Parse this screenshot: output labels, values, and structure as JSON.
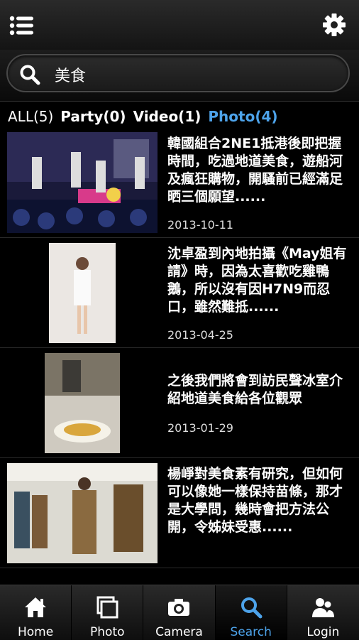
{
  "header": {
    "menu_icon": "hamburger-menu-icon",
    "settings_icon": "gear-icon"
  },
  "search": {
    "value": "美食",
    "icon": "search-icon"
  },
  "filters": [
    {
      "label": "ALL(5)"
    },
    {
      "label": "Party(0)"
    },
    {
      "label": "Video(1)"
    },
    {
      "label": "Photo(4)"
    }
  ],
  "results": [
    {
      "title": "韓國組合2NE1抵港後即把握時間，吃過地道美食，遊船河及瘋狂購物，開騷前已經滿足晒三個願望......",
      "date": "2013-10-11"
    },
    {
      "title": "沈卓盈到內地拍攝《May姐有請》時，因為太喜歡吃雞鴨鵝，所以沒有因H7N9而忍口，雖然難抵......",
      "date": "2013-04-25"
    },
    {
      "title": "之後我們將會到訪民聲冰室介紹地道美食給各位觀眾",
      "date": "2013-01-29"
    },
    {
      "title": "楊崢對美食素有研究，但如何可以像她一樣保持苗條，那才是大學問，幾時會把方法公開，令姊妹受惠......",
      "date": ""
    }
  ],
  "tabs": [
    {
      "label": "Home",
      "icon": "home-icon"
    },
    {
      "label": "Photo",
      "icon": "photo-icon"
    },
    {
      "label": "Camera",
      "icon": "camera-icon"
    },
    {
      "label": "Search",
      "icon": "search-icon"
    },
    {
      "label": "Login",
      "icon": "users-icon"
    }
  ],
  "colors": {
    "accent": "#4da3ea",
    "background": "#000000"
  }
}
